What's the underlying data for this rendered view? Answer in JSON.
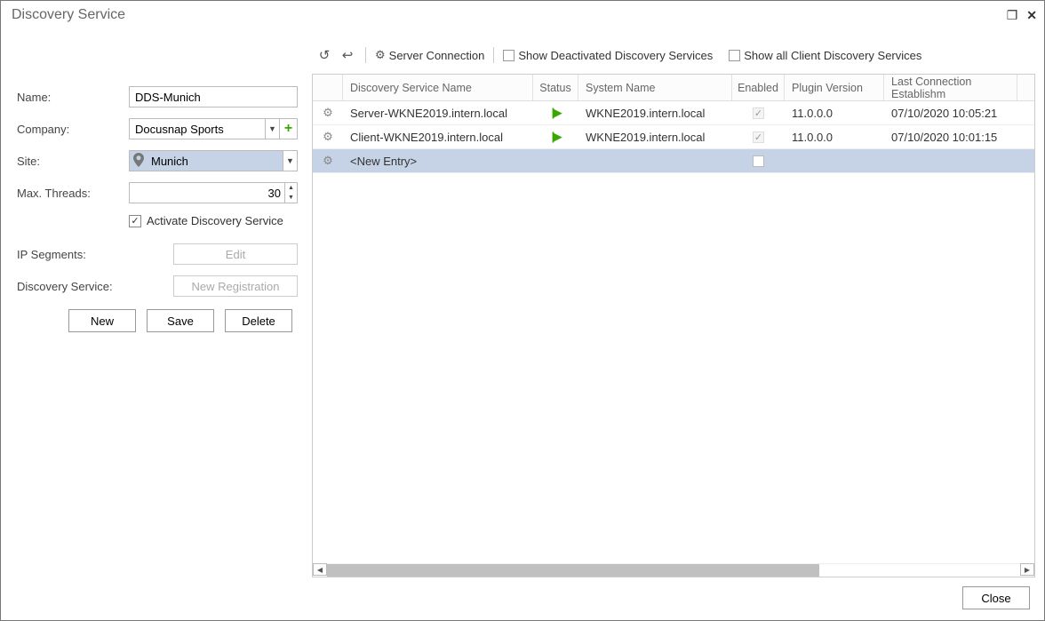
{
  "window": {
    "title": "Discovery Service"
  },
  "form": {
    "name_label": "Name:",
    "name_value": "DDS-Munich",
    "company_label": "Company:",
    "company_value": "Docusnap Sports",
    "site_label": "Site:",
    "site_value": "Munich",
    "threads_label": "Max. Threads:",
    "threads_value": "30",
    "activate_label": "Activate Discovery Service",
    "activate_checked": true,
    "ipseg_label": "IP Segments:",
    "ipseg_btn": "Edit",
    "dsrv_label": "Discovery Service:",
    "dsrv_btn": "New Registration",
    "new_btn": "New",
    "save_btn": "Save",
    "del_btn": "Delete"
  },
  "toolbar": {
    "server_conn": "Server Connection",
    "show_deact": "Show Deactivated Discovery Services",
    "show_all": "Show all Client Discovery Services"
  },
  "grid": {
    "headers": {
      "name": "Discovery Service Name",
      "status": "Status",
      "system": "System Name",
      "enabled": "Enabled",
      "plugin": "Plugin Version",
      "last": "Last Connection Establishm"
    },
    "rows": [
      {
        "name": "Server-WKNE2019.intern.local",
        "system": "WKNE2019.intern.local",
        "enabled": true,
        "plugin": "11.0.0.0",
        "last": "07/10/2020 10:05:21",
        "selected": false
      },
      {
        "name": "Client-WKNE2019.intern.local",
        "system": "WKNE2019.intern.local",
        "enabled": true,
        "plugin": "11.0.0.0",
        "last": "07/10/2020 10:01:15",
        "selected": false
      },
      {
        "name": "<New Entry>",
        "system": "",
        "enabled": false,
        "plugin": "",
        "last": "",
        "selected": true
      }
    ]
  },
  "footer": {
    "close": "Close"
  }
}
